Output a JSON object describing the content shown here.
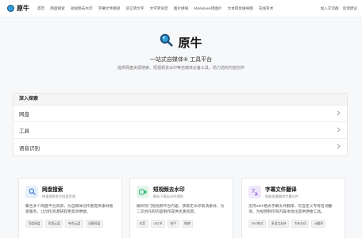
{
  "app": {
    "logo_text": "原牛"
  },
  "nav": {
    "items": [
      "首页",
      "网盘搜索",
      "短视频去水印",
      "字幕文件翻译",
      "语言转文字",
      "文字转语音",
      "图片拼缝",
      "Markdown转图片",
      "文本转思维导图",
      "在线有术"
    ],
    "right": [
      "加入交流群",
      "反馈建议"
    ]
  },
  "hero": {
    "title": "原牛",
    "subtitle": "一站式自媒体⑥ 工具平台",
    "description": "提供网盘资源搜索、短视频去水印等自媒体必备工具，助力您的内容创作"
  },
  "explore": {
    "title": "深入探索",
    "rows": [
      "网盘",
      "工具",
      "语音识别"
    ]
  },
  "cards": [
    {
      "title": "网盘搜索",
      "subtitle": "快速搜索各大网盘资源",
      "desc": "聚合多个网盘平台资源，为自媒体创作者提供素材搜索服务，让创作资源获取更高效便捷。",
      "tags": [
        "百度网盘",
        "阿里云盘",
        "夸克云盘",
        "迅雷网盘"
      ],
      "icon": "search-icon",
      "icon_color": "#3a7bd5",
      "icon_bg": "#e6f0fb"
    },
    {
      "title": "短视频去水印",
      "subtitle": "解析下载无水印视频",
      "desc": "解析热门短视频平台内容，获取无水印高清素材，为二次创作和内容制作提供优质资源。",
      "tags": [
        "抖音",
        "小红书",
        "快手",
        "微博"
      ],
      "icon": "video-icon",
      "icon_color": "#2bb673",
      "icon_bg": "#e4f6ec"
    },
    {
      "title": "字幕文件翻译",
      "subtitle": "智能批量翻译字幕文件",
      "desc": "支持SRT格式字幕文件翻译，可自定义专有名词翻译，为视频制作和内容本地化提供便捷工具。",
      "tags": [
        "SRT格式",
        "多语言支持",
        "专有名词",
        "AI翻译"
      ],
      "icon": "translate-icon",
      "icon_color": "#8a5cd6",
      "icon_bg": "#efe7fb"
    }
  ],
  "colors": {
    "brand": "#2f9bd6",
    "accent_dark": "#1b4f7a"
  }
}
